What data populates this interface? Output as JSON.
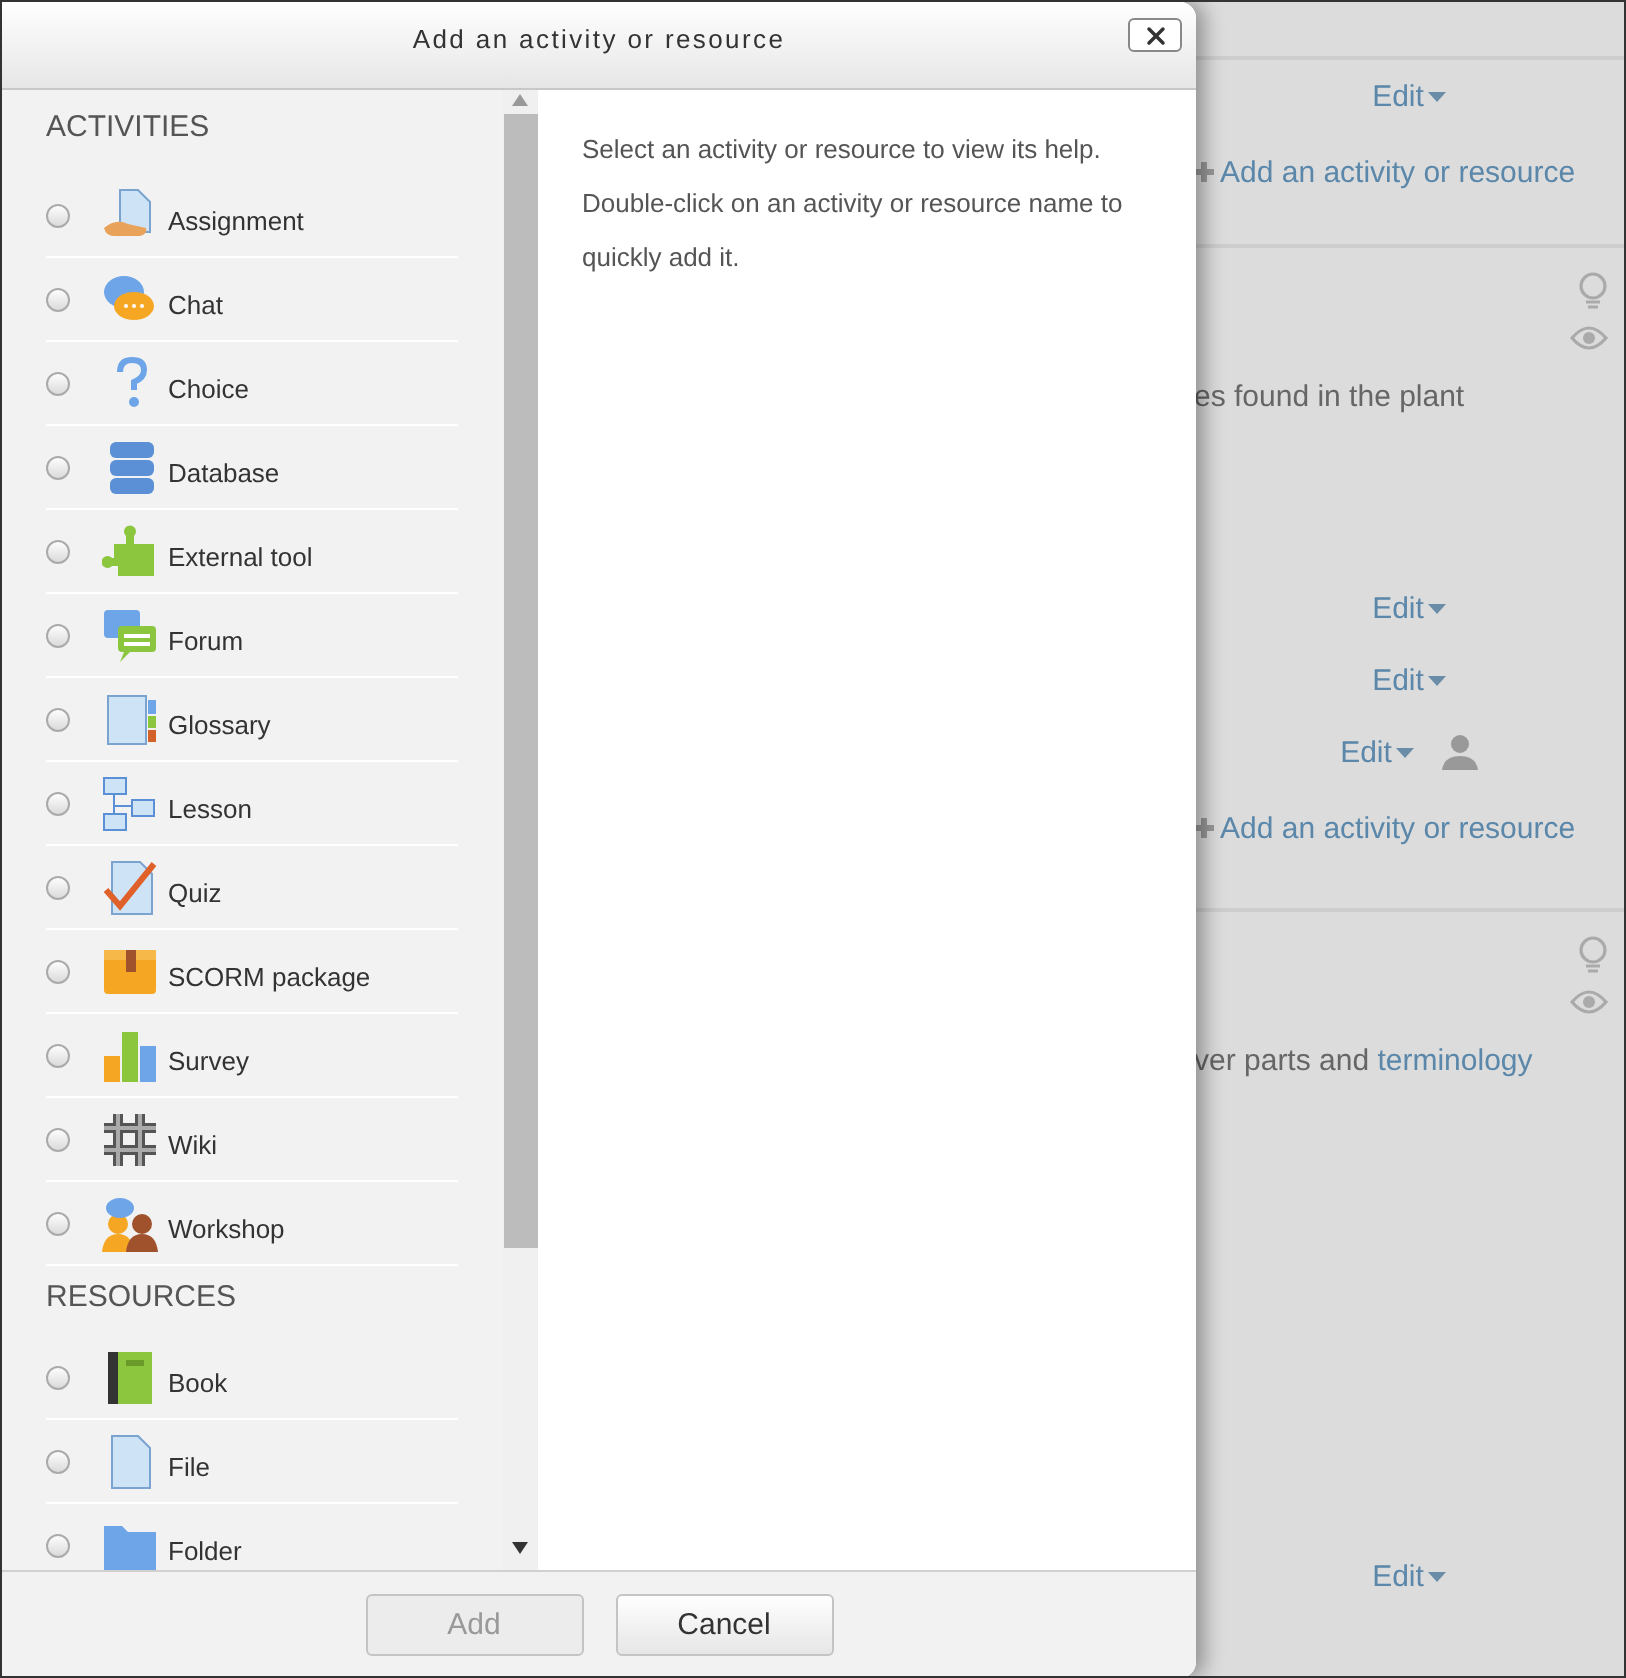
{
  "course_page": {
    "sections": [
      {
        "rows": [
          {
            "kind": "edit",
            "text": "Edit"
          },
          {
            "kind": "add",
            "text": "Add an activity or resource"
          }
        ]
      },
      {
        "rows": [
          {
            "kind": "bulb"
          },
          {
            "kind": "eye"
          },
          {
            "kind": "text",
            "text": "es found in the plant"
          },
          {
            "kind": "edit",
            "text": "Edit"
          },
          {
            "kind": "edit",
            "text": "Edit"
          },
          {
            "kind": "edit",
            "text": "Edit",
            "person": true
          },
          {
            "kind": "add",
            "text": "Add an activity or resource"
          }
        ]
      },
      {
        "rows": [
          {
            "kind": "bulb"
          },
          {
            "kind": "eye"
          },
          {
            "kind": "text",
            "text": "ver parts and ",
            "link": "terminology"
          },
          {
            "kind": "edit",
            "text": "Edit"
          }
        ]
      }
    ]
  },
  "dialog": {
    "title": "Add an activity or resource",
    "sections": [
      {
        "heading": "ACTIVITIES",
        "items": [
          {
            "label": "Assignment",
            "kind": "assignment",
            "selected": false
          },
          {
            "label": "Chat",
            "kind": "chat",
            "selected": false
          },
          {
            "label": "Choice",
            "kind": "choice",
            "selected": false
          },
          {
            "label": "Database",
            "kind": "database",
            "selected": false
          },
          {
            "label": "External tool",
            "kind": "puzzle",
            "selected": false
          },
          {
            "label": "Forum",
            "kind": "forum",
            "selected": false
          },
          {
            "label": "Glossary",
            "kind": "glossary",
            "selected": false
          },
          {
            "label": "Lesson",
            "kind": "lesson",
            "selected": false
          },
          {
            "label": "Quiz",
            "kind": "quiz",
            "selected": false
          },
          {
            "label": "SCORM package",
            "kind": "package",
            "selected": false
          },
          {
            "label": "Survey",
            "kind": "survey",
            "selected": false
          },
          {
            "label": "Wiki",
            "kind": "wiki",
            "selected": false
          },
          {
            "label": "Workshop",
            "kind": "workshop",
            "selected": false
          }
        ]
      },
      {
        "heading": "RESOURCES",
        "items": [
          {
            "label": "Book",
            "kind": "book",
            "selected": false
          },
          {
            "label": "File",
            "kind": "file",
            "selected": false
          },
          {
            "label": "Folder",
            "kind": "folder",
            "selected": false
          }
        ]
      }
    ],
    "help": [
      "Select an activity or resource to view its help.",
      "Double-click on an activity or resource name to",
      "quickly add it."
    ],
    "buttons": [
      {
        "label": "Add",
        "disabled": true
      },
      {
        "label": "Cancel",
        "disabled": false
      }
    ]
  }
}
